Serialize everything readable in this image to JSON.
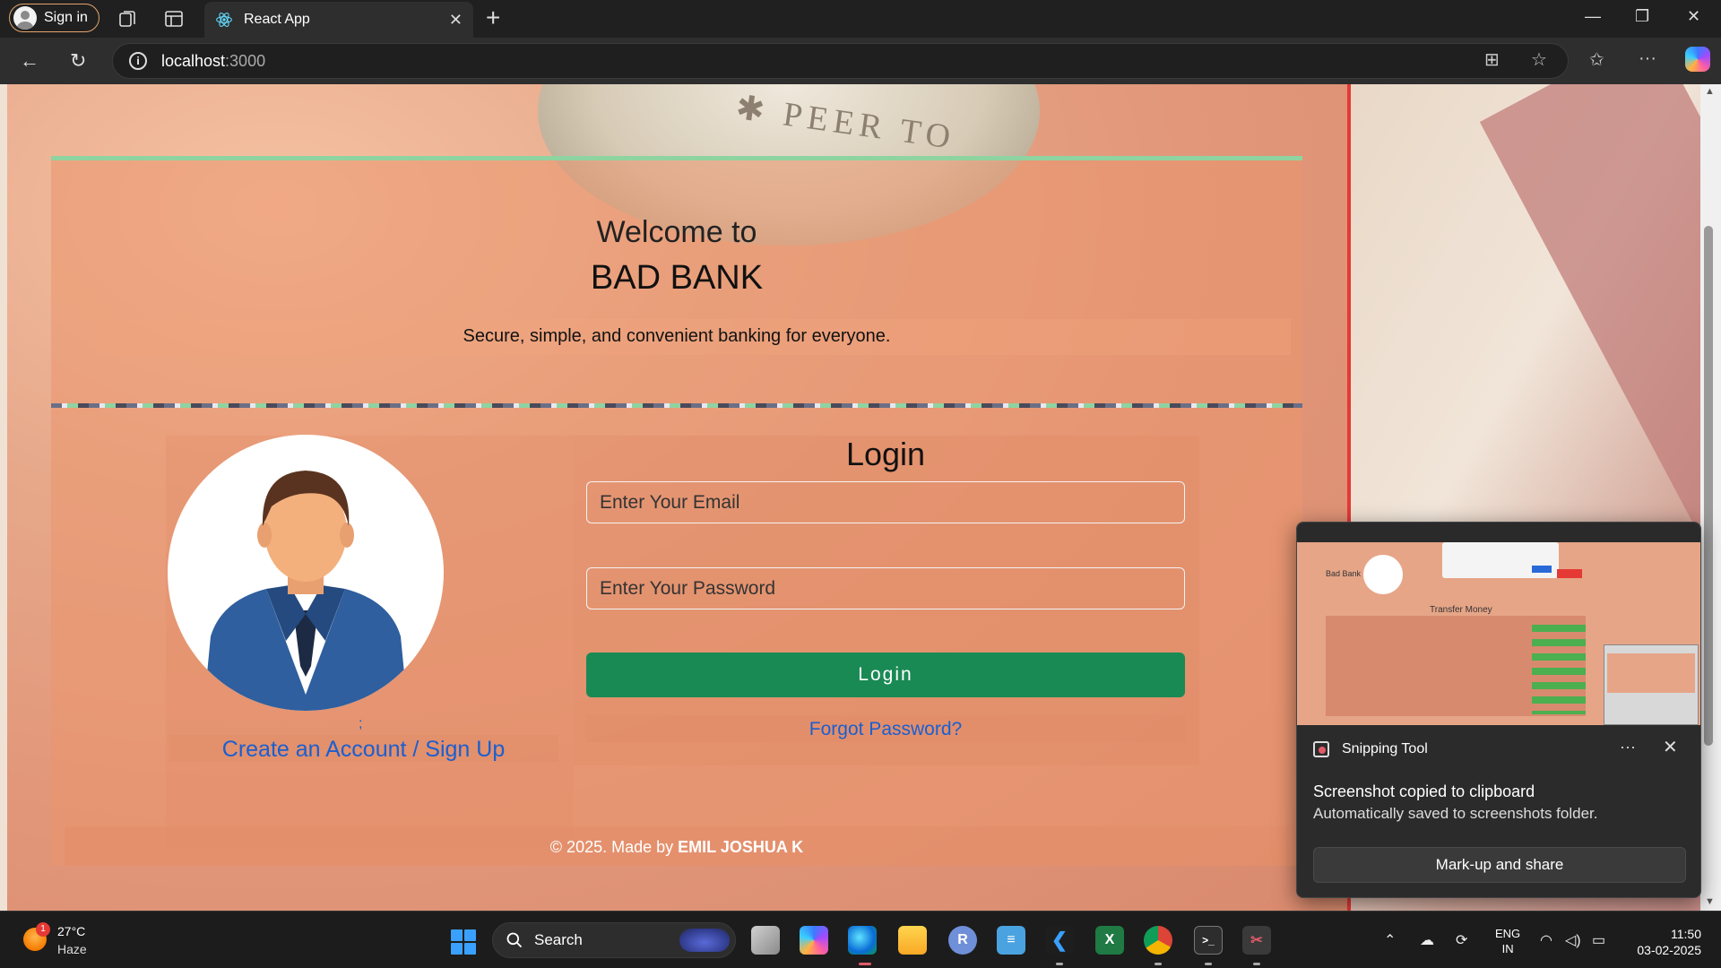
{
  "browser": {
    "signin_label": "Sign in",
    "tab_title": "React App",
    "url_host": "localhost",
    "url_port": ":3000"
  },
  "page": {
    "welcome": "Welcome to",
    "brand": "BAD BANK",
    "tagline": "Secure, simple, and convenient banking for everyone.",
    "signup_link": "Create an Account / Sign Up",
    "semicolon": ";",
    "login": {
      "title": "Login",
      "email_placeholder": "Enter Your Email",
      "password_placeholder": "Enter Your Password",
      "button": "Login",
      "forgot": "Forgot Password?"
    },
    "footer_prefix": "© 2025. Made by ",
    "footer_author": "EMIL JOSHUA K"
  },
  "coin": {
    "text": "✱ PEER TO"
  },
  "toast": {
    "app": "Snipping Tool",
    "title": "Screenshot copied to clipboard",
    "subtitle": "Automatically saved to screenshots folder.",
    "button": "Mark-up and share",
    "thumbnail": {
      "bank": "Bad Bank",
      "heading": "Transfer Money"
    }
  },
  "taskbar": {
    "weather_temp": "27°C",
    "weather_cond": "Haze",
    "weather_badge": "1",
    "search_label": "Search",
    "lang_top": "ENG",
    "lang_bottom": "IN",
    "time": "11:50",
    "date": "03-02-2025"
  },
  "colors": {
    "login_button": "#1a8a55",
    "link": "#1a5fd0",
    "accent_bar": "#8fd3a0"
  }
}
